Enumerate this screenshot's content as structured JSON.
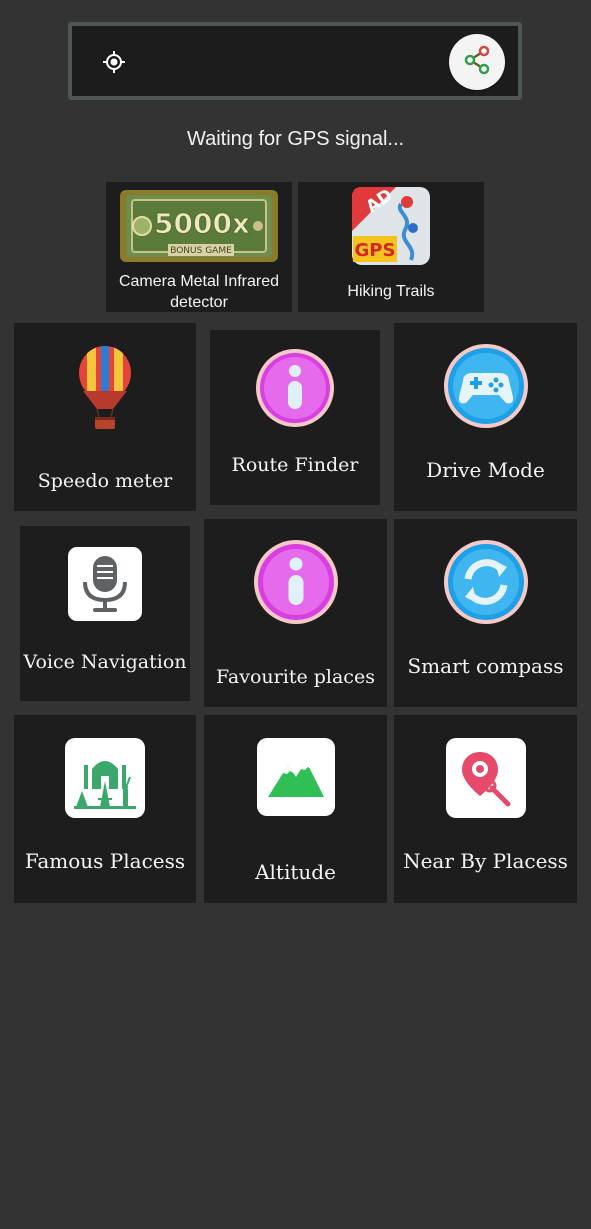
{
  "search": {
    "locate_icon": "crosshair-icon",
    "share_icon": "share-icon"
  },
  "status": {
    "text": "Waiting for GPS signal..."
  },
  "ads": [
    {
      "label": "Camera Metal Infrared detector",
      "badge_text": "5000x",
      "badge_sub": "BONUS GAME"
    },
    {
      "label": "Hiking Trails",
      "badge_ad": "AD",
      "badge_gps": "GPS"
    }
  ],
  "tiles": [
    {
      "label": "Speedo meter",
      "icon": "hot-air-balloon-icon"
    },
    {
      "label": "Route Finder",
      "icon": "info-icon"
    },
    {
      "label": "Drive Mode",
      "icon": "gamepad-icon"
    },
    {
      "label": "Voice Navigation",
      "icon": "microphone-icon"
    },
    {
      "label": "Favourite places",
      "icon": "info-icon"
    },
    {
      "label": "Smart compass",
      "icon": "refresh-icon"
    },
    {
      "label": "Famous Placess",
      "icon": "landmarks-icon"
    },
    {
      "label": "Altitude",
      "icon": "mountain-icon"
    },
    {
      "label": "Near By Placess",
      "icon": "location-search-icon"
    }
  ],
  "colors": {
    "background": "#333333",
    "tile": "#1d1d1d",
    "info_purple": "#d93fe0",
    "gamepad_blue": "#1ea0e6",
    "mountain_green": "#2fbf55",
    "landmark_green": "#3aa86a",
    "pin_red": "#e64a6a"
  }
}
